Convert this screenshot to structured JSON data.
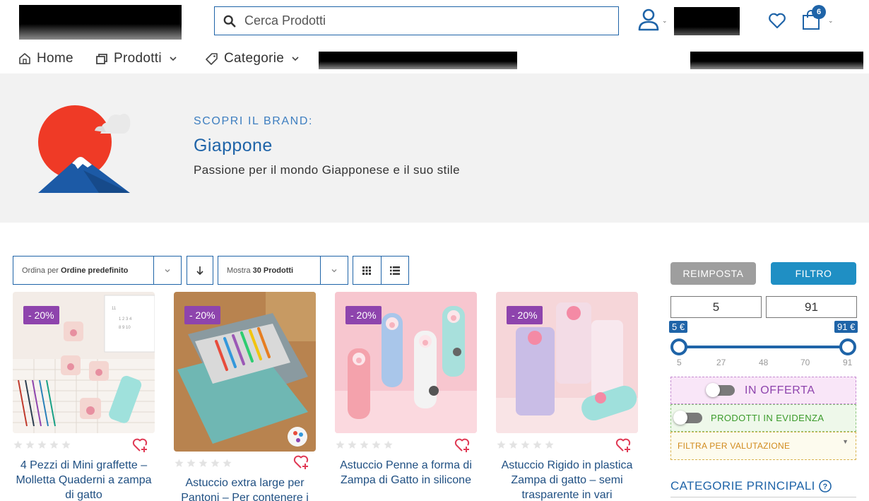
{
  "search": {
    "placeholder": "Cerca Prodotti"
  },
  "cart": {
    "count": "6"
  },
  "nav": {
    "home": "Home",
    "products": "Prodotti",
    "categories": "Categorie"
  },
  "brand": {
    "kicker": "SCOPRI IL BRAND:",
    "name": "Giappone",
    "description": "Passione per il mondo Giapponese e il suo stile"
  },
  "toolbar": {
    "sort_prefix": "Ordina per",
    "sort_value": "Ordine predefinito",
    "show_prefix": "Mostra",
    "show_value": "30 Prodotti"
  },
  "products": [
    {
      "badge": "- 20%",
      "title": "4 Pezzi di Mini graffette – Molletta Quaderni a zampa di gatto"
    },
    {
      "badge": "- 20%",
      "title": "Astuccio extra large per Pantoni – Per contenere i"
    },
    {
      "badge": "- 20%",
      "title": "Astuccio Penne a forma di Zampa di Gatto in silicone"
    },
    {
      "badge": "- 20%",
      "title": "Astuccio Rigido in plastica Zampa di gatto – semi trasparente in vari"
    }
  ],
  "filters": {
    "reset_label": "REIMPOSTA",
    "filter_label": "FILTRO",
    "price_min": "5",
    "price_max": "91",
    "tip_min": "5 €",
    "tip_max": "91 €",
    "ticks": [
      "5",
      "27",
      "48",
      "70",
      "91"
    ],
    "on_sale": "IN OFFERTA",
    "featured": "PRODOTTI IN EVIDENZA",
    "rating": "FILTRA PER VALUTAZIONE",
    "categories_title": "CATEGORIE PRINCIPALI"
  },
  "colors": {
    "accent": "#1f64a8",
    "badge": "#8e44ad",
    "filter_button": "#1f8fc4",
    "reset_button": "#9e9e9e"
  }
}
